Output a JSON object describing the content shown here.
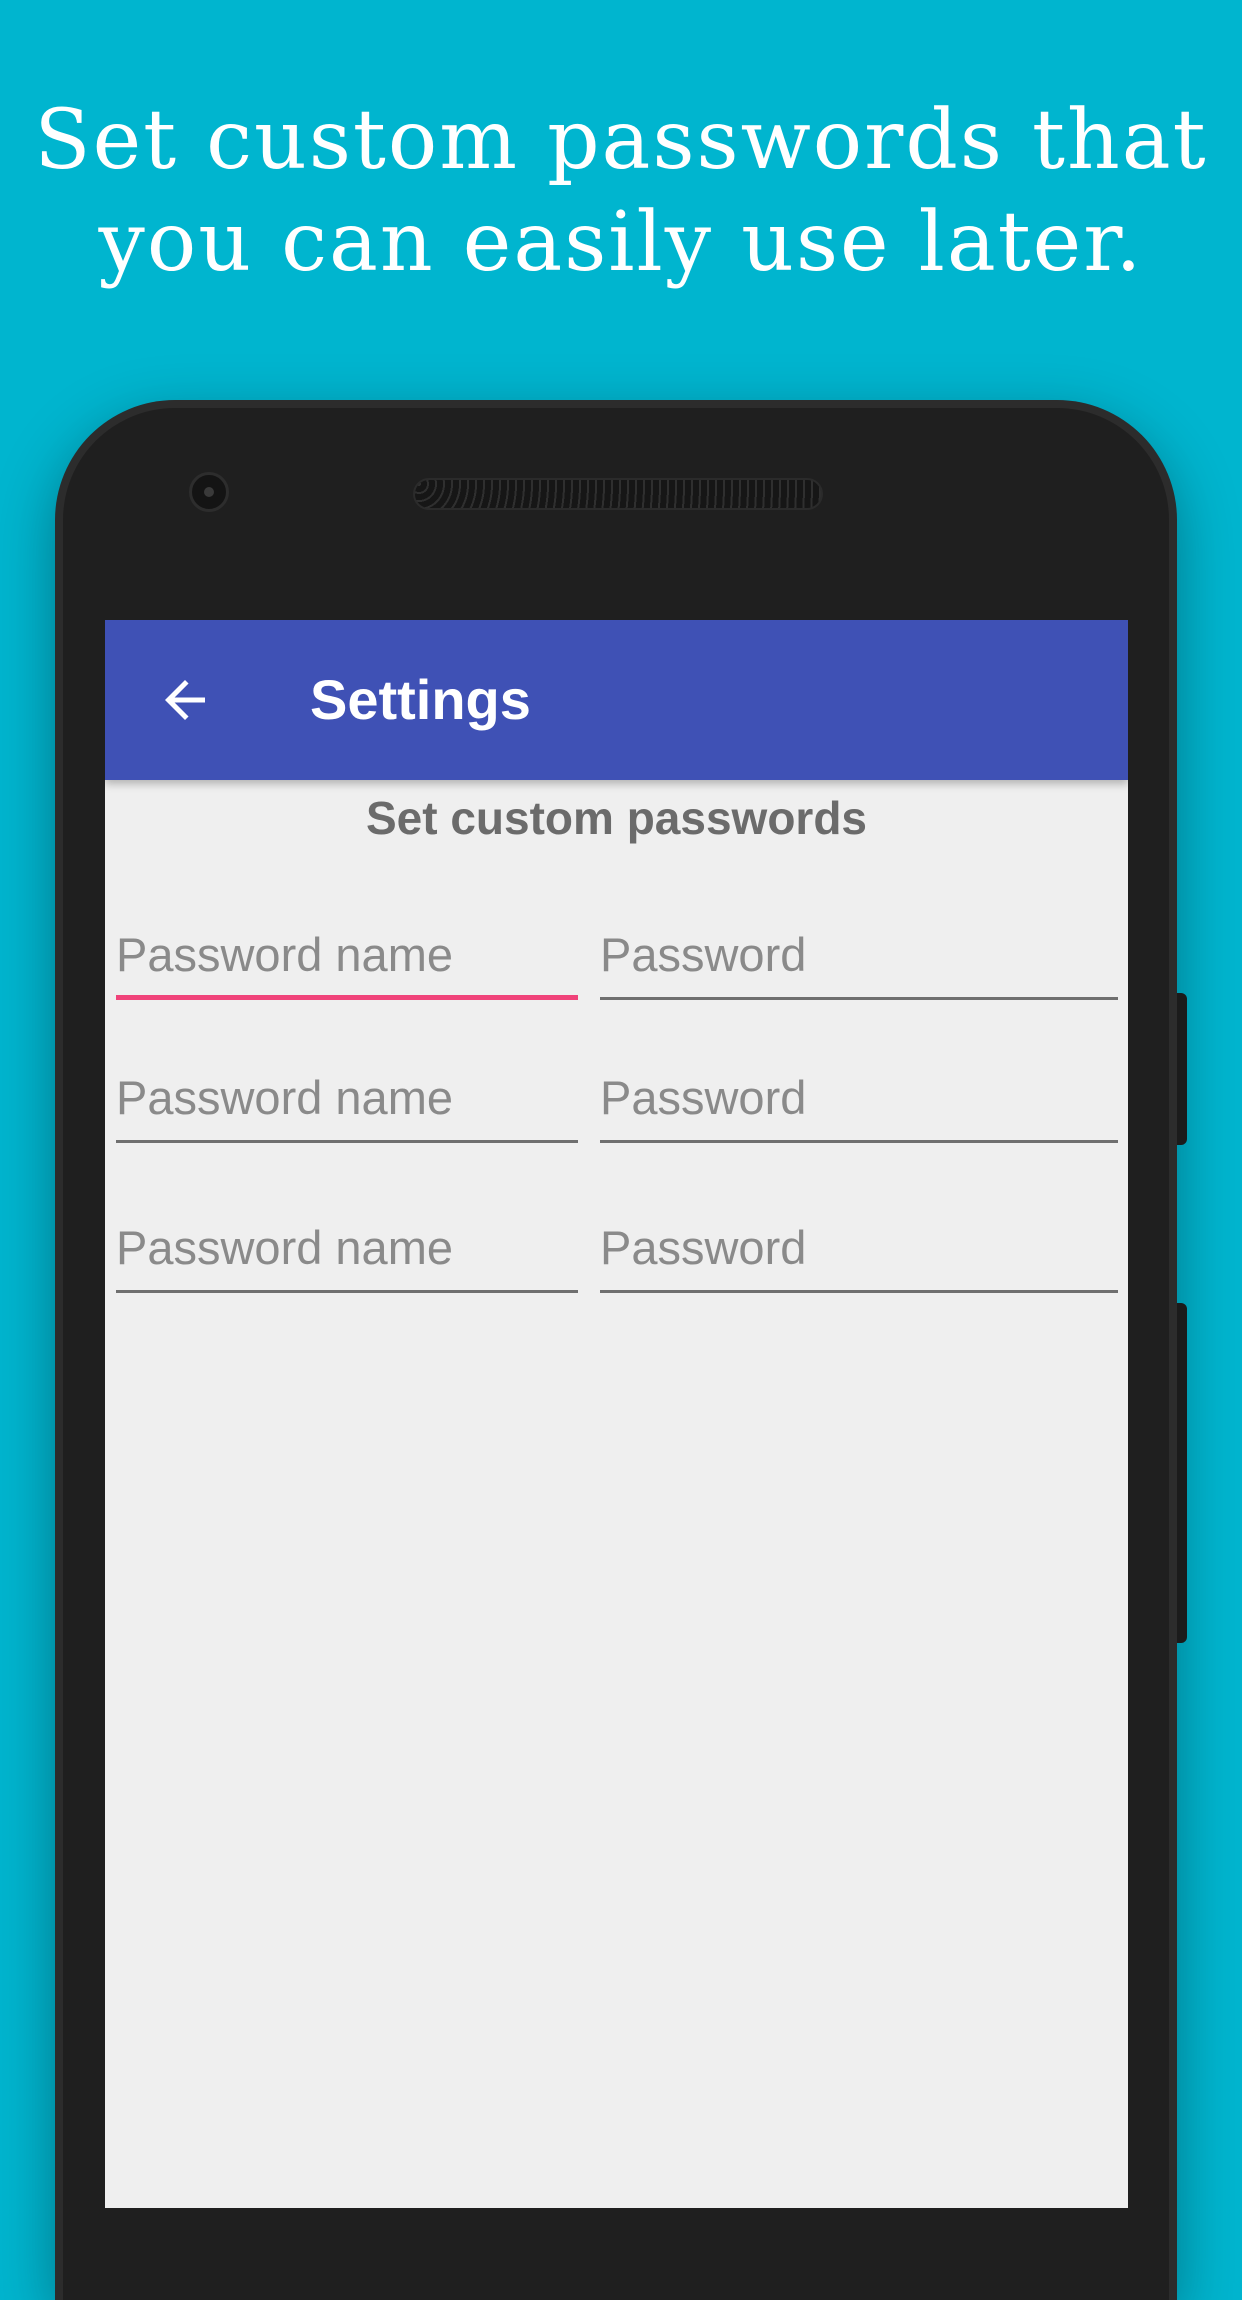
{
  "headline": {
    "line1": "Set custom passwords that",
    "line2": "you can easily use later."
  },
  "appbar": {
    "title": "Settings",
    "back_icon": "arrow-left-icon"
  },
  "content": {
    "section_title": "Set custom passwords",
    "rows": [
      {
        "name_placeholder": "Password name",
        "password_placeholder": "Password"
      },
      {
        "name_placeholder": "Password name",
        "password_placeholder": "Password"
      },
      {
        "name_placeholder": "Password name",
        "password_placeholder": "Password"
      }
    ]
  },
  "colors": {
    "background": "#00b5cf",
    "appbar": "#3f51b5",
    "focus_accent": "#f0437a",
    "screen_bg": "#efefef"
  }
}
